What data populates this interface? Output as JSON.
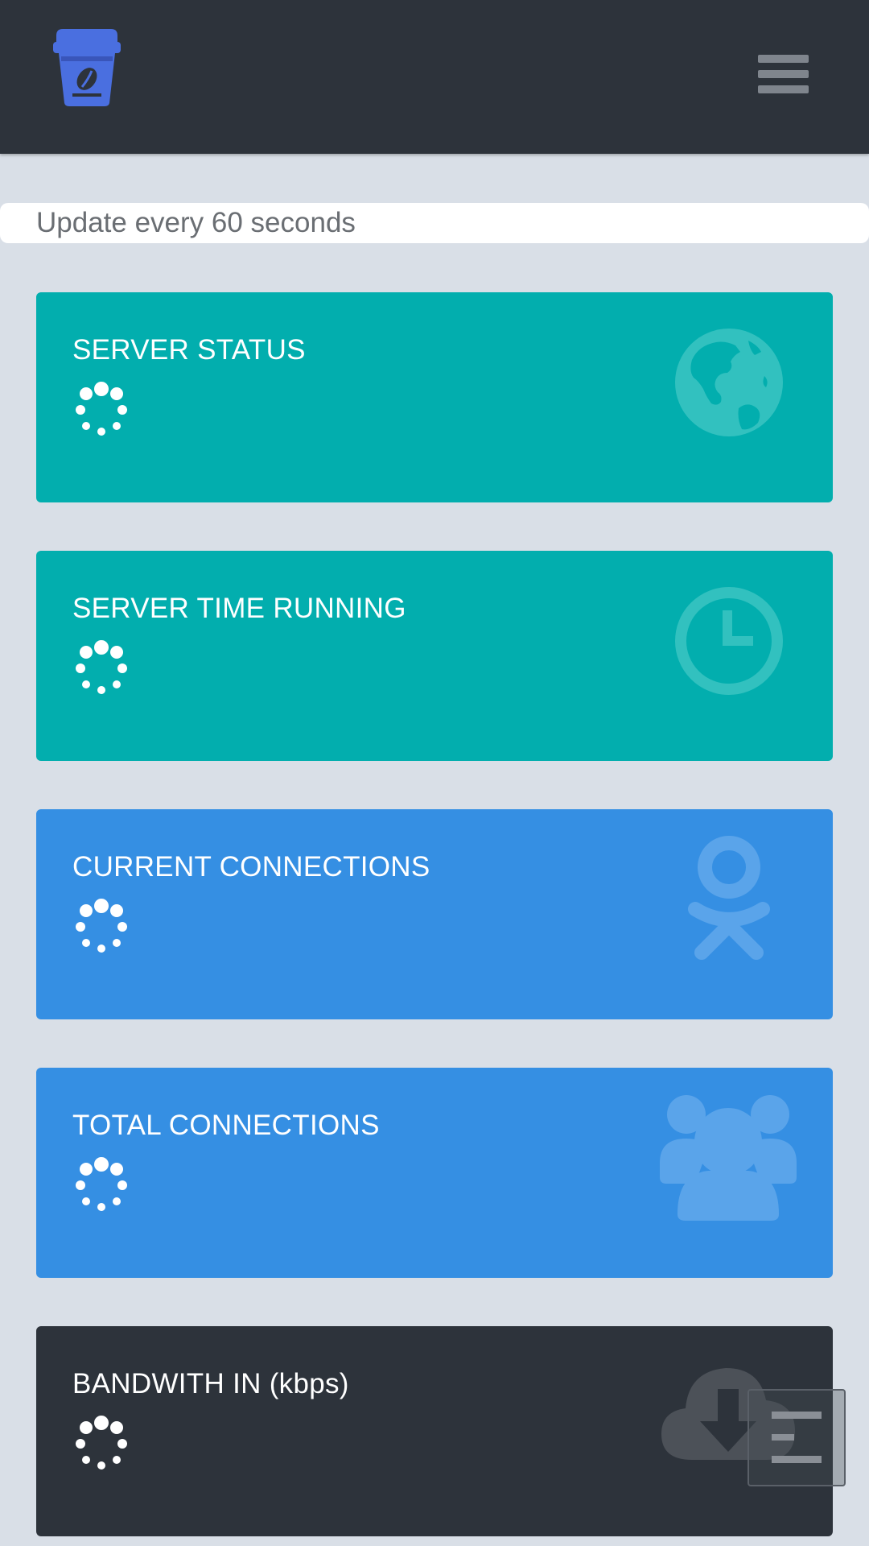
{
  "header": {
    "logo": "coffee-cup-icon",
    "menu_icon": "hamburger-menu-icon"
  },
  "update_text": "Update every 60 seconds",
  "cards": [
    {
      "title": "SERVER STATUS",
      "color": "#02aeae",
      "icon": "globe-icon",
      "loading": true
    },
    {
      "title": "SERVER TIME RUNNING",
      "color": "#02aeae",
      "icon": "clock-icon",
      "loading": true
    },
    {
      "title": "CURRENT CONNECTIONS",
      "color": "#358fe3",
      "icon": "odnoklassniki-person-icon",
      "loading": true
    },
    {
      "title": "TOTAL CONNECTIONS",
      "color": "#358fe3",
      "icon": "users-group-icon",
      "loading": true
    },
    {
      "title": "BANDWITH IN (kbps)",
      "color": "#2d333b",
      "icon": "cloud-download-icon",
      "loading": true
    }
  ],
  "floating_button": {
    "icon": "scroll-to-top-icon"
  },
  "colors": {
    "topbar": "#2d333b",
    "background": "#d9dfe7",
    "teal": "#02aeae",
    "blue": "#358fe3",
    "logo": "#4a6fe0"
  }
}
